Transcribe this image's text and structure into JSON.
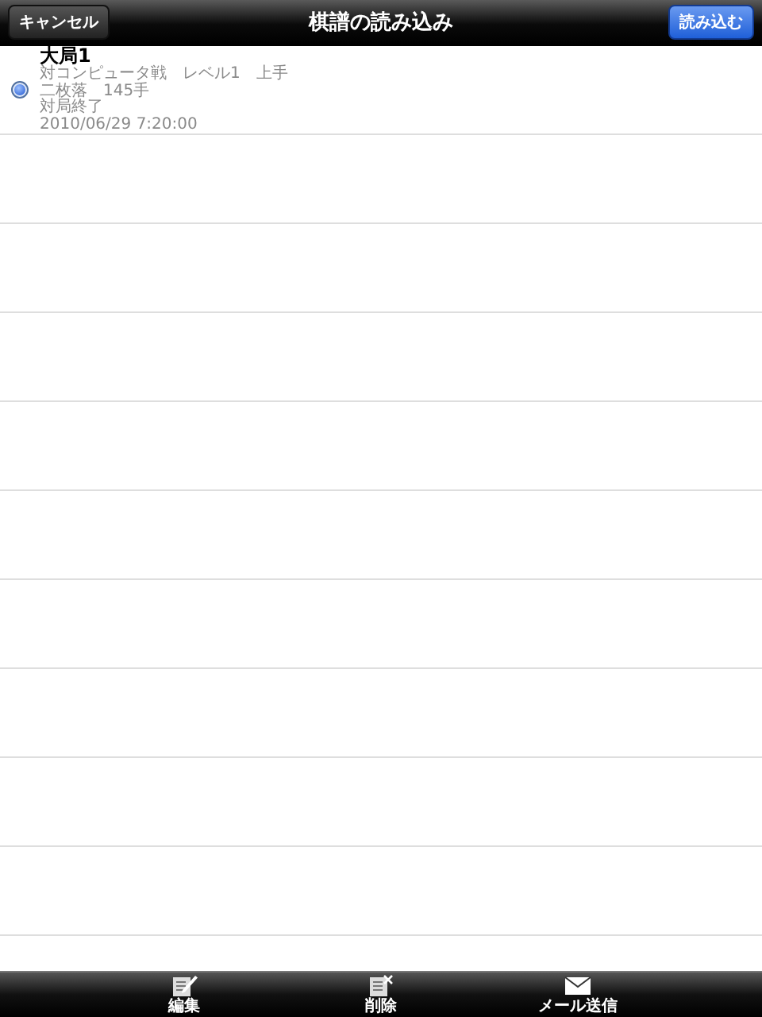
{
  "nav_bar": {
    "title": "棋譜の読み込み",
    "left_button": "キャンセル",
    "right_button": "読み込む"
  },
  "games": [
    {
      "title": "大局1",
      "lines": [
        "対コンピュータ戦　レベル1　上手",
        "二枚落　145手",
        "対局終了",
        "2010/06/29 7:20:00"
      ],
      "selected": true
    }
  ],
  "toolbar": [
    {
      "label": "編集",
      "kind": "edit"
    },
    {
      "label": "削除",
      "kind": "delete"
    },
    {
      "label": "メール送信",
      "kind": "mail"
    }
  ]
}
